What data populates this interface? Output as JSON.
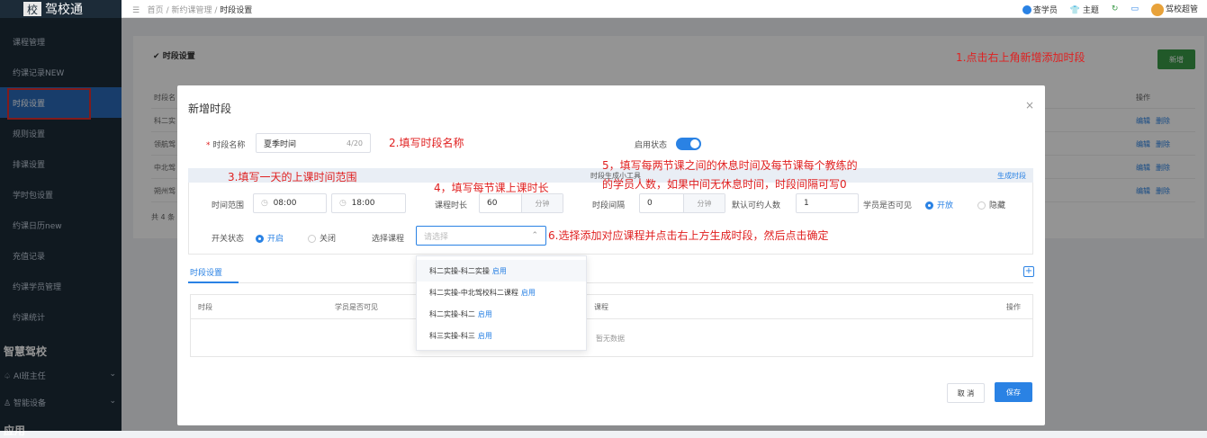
{
  "sidebar": {
    "logo": "驾校通",
    "logo_char": "校",
    "items": [
      "课程管理",
      "约课记录NEW",
      "时段设置",
      "规则设置",
      "排课设置",
      "学时包设置",
      "约课日历new",
      "充值记录",
      "约课学员管理",
      "约课统计"
    ],
    "section1": "智慧驾校",
    "sub1": "AI班主任",
    "sub2": "智能设备",
    "section2": "应用"
  },
  "topbar": {
    "crumb_home": "首页",
    "crumb_sep": "/",
    "crumb_mid": "新约课管理",
    "crumb_current": "时段设置",
    "search_student": "查学员",
    "theme": "主题",
    "user": "驾校超管"
  },
  "page": {
    "title": "时段设置",
    "new_button": "新增",
    "bg_header_col1": "时段名",
    "bg_header_ops": "操作",
    "bg_rows": [
      "科二实",
      "领航驾",
      "中北驾",
      "朔州驾"
    ],
    "edit": "编辑",
    "delete": "删除",
    "total": "共 4 条"
  },
  "annotations": {
    "a1": "1.点击右上角新增添加时段",
    "a2": "2.填写时段名称",
    "a3": "3.填写一天的上课时间范围",
    "a4": "4，填写每节课上课时长",
    "a5_line1": "5，填写每两节课之间的休息时间及每节课每个教练的",
    "a5_line2": "的学员人数，如果中间无休息时间，时段间隔可写0",
    "a6": "6.选择添加对应课程并点击右上方生成时段，然后点击确定"
  },
  "modal": {
    "title": "新增时段",
    "close": "×",
    "name_label": "时段名称",
    "name_value": "夏季时间",
    "name_count": "4/20",
    "enable_label": "启用状态",
    "gen_bar_title": "时段生成小工具",
    "gen_link": "生成时段",
    "range_label": "时间范围",
    "time_start": "08:00",
    "time_end": "18:00",
    "duration_label": "课程时长",
    "duration_value": "60",
    "unit_minute": "分钟",
    "interval_label": "时段间隔",
    "interval_value": "0",
    "default_count_label": "默认可约人数",
    "default_count_value": "1",
    "visible_label": "学员是否可见",
    "visible_open": "开放",
    "visible_hidden": "隐藏",
    "switch_label": "开关状态",
    "switch_on": "开启",
    "switch_off": "关闭",
    "course_label": "选择课程",
    "course_placeholder": "请选择",
    "tab_label": "时段设置",
    "table_headers": [
      "时段",
      "学员是否可见",
      "课程",
      "操作"
    ],
    "empty_text": "暂无数据",
    "dropdown": [
      {
        "name": "科二实操-科二实操",
        "status": "启用"
      },
      {
        "name": "科二实操-中北驾校科二课程",
        "status": "启用"
      },
      {
        "name": "科二实操-科二",
        "status": "启用"
      },
      {
        "name": "科三实操-科三",
        "status": "启用"
      }
    ],
    "cancel": "取 消",
    "save": "保存"
  }
}
